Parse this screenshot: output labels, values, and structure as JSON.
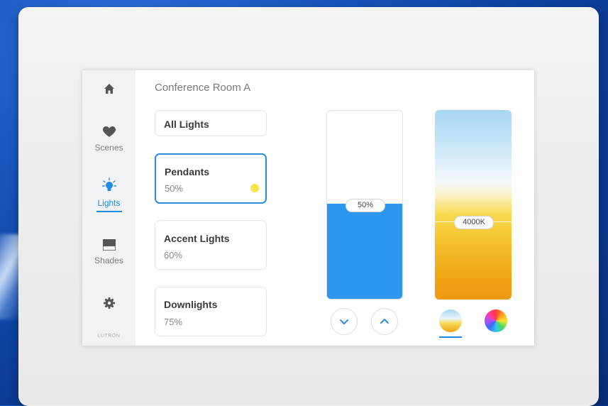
{
  "sidebar": {
    "items": [
      {
        "icon": "home-icon",
        "label": ""
      },
      {
        "icon": "heart-icon",
        "label": "Scenes"
      },
      {
        "icon": "lightbulb-icon",
        "label": "Lights"
      },
      {
        "icon": "shade-icon",
        "label": "Shades"
      },
      {
        "icon": "gear-icon",
        "label": ""
      }
    ],
    "active": "Lights",
    "brand": "LUTRON"
  },
  "header": {
    "room": "Conference Room A"
  },
  "zones": [
    {
      "name": "All Lights",
      "level": ""
    },
    {
      "name": "Pendants",
      "level": "50%",
      "selected": true
    },
    {
      "name": "Accent Lights",
      "level": "60%"
    },
    {
      "name": "Downlights",
      "level": "75%"
    }
  ],
  "dimmer": {
    "label": "50%",
    "level": 0.5
  },
  "color_temp": {
    "label": "4000K"
  },
  "colors": {
    "accent": "#1e8ae8",
    "fill": "#2d96ee",
    "indicator": "#f5e44a"
  }
}
